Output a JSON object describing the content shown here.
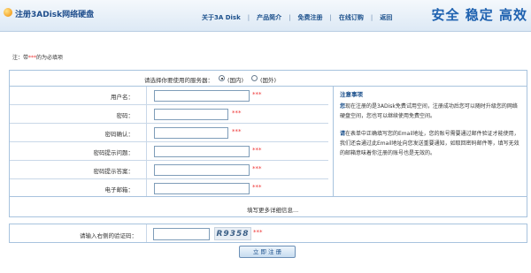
{
  "header": {
    "site_title": "注册3ADisk网络硬盘",
    "nav": [
      "关于3A Disk",
      "产品简介",
      "免费注册",
      "在线订购",
      "返回"
    ],
    "slogan": "安全 稳定 高效"
  },
  "note": {
    "prefix": "注：带",
    "mark": "***",
    "suffix": "的为必填项"
  },
  "server": {
    "label": "请选择你要使用的服务器：",
    "options": [
      {
        "label": "(国内)",
        "selected": true
      },
      {
        "label": "(国外)",
        "selected": false
      }
    ]
  },
  "fields": [
    {
      "label": "用户名：",
      "value": "",
      "required_mark": "***"
    },
    {
      "label": "密码：",
      "value": "",
      "required_mark": "***"
    },
    {
      "label": "密码确认：",
      "value": "",
      "required_mark": "***"
    },
    {
      "label": "密码提示问题：",
      "value": "",
      "required_mark": "***"
    },
    {
      "label": "密码提示答案：",
      "value": "",
      "required_mark": "***"
    },
    {
      "label": "电子邮箱：",
      "value": "",
      "required_mark": "***"
    }
  ],
  "tips": {
    "title": "注意事项",
    "p1_lead": "您",
    "p1": "现在注册的是3ADisk免费试用空间，注册成功后您可以随时升级您的网络硬盘空间，您也可以继续使用免费空间。",
    "p2_lead": "请",
    "p2": "在表单中正确填写您的Email地址，您的账号需要通过邮件验证才能使用，我们还会通过此Email地址向您发送重要通知，如取回密码邮件等，填写无效的邮箱意味着你注册的账号也是无效的。"
  },
  "more_link": "填写更多详细信息...",
  "captcha": {
    "label": "请输入右侧的验证码：",
    "image_text": "R9358",
    "required_mark": "***"
  },
  "submit_label": "立 即 注 册",
  "colors": {
    "brand_blue": "#1f62b0",
    "link_blue": "#1a4f8b",
    "required_red": "#ee3333",
    "border_blue": "#a8c3de"
  }
}
